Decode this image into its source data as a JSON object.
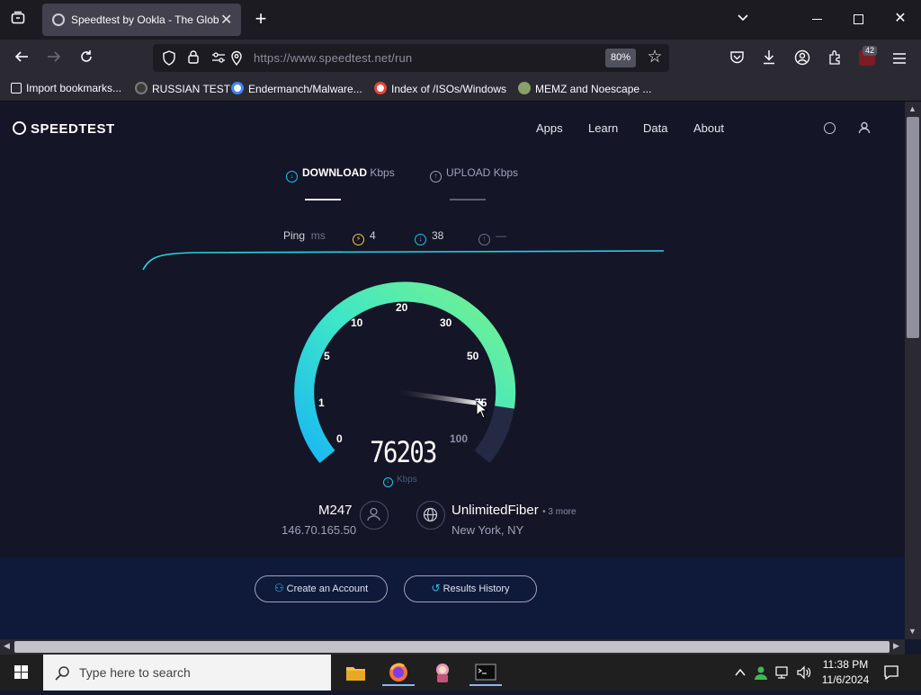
{
  "browser": {
    "tab_title": "Speedtest by Ookla - The Global Broadband Speed Test",
    "tab_close": "✕",
    "new_tab": "+",
    "url": "https://www.speedtest.net/run",
    "zoom": "80%",
    "badge_count": "42",
    "bookmarks": [
      {
        "label": "Import bookmarks...",
        "icon": "import-icon"
      },
      {
        "label": "RUSSIAN TEST",
        "icon": "github-icon"
      },
      {
        "label": "Endermanch/Malware...",
        "icon": "google-icon"
      },
      {
        "label": "Index of /ISOs/Windows",
        "icon": "google-icon"
      },
      {
        "label": "MEMZ and Noescape ...",
        "icon": "site-icon"
      }
    ]
  },
  "site": {
    "logo": "SPEEDTEST",
    "nav": [
      "Apps",
      "Learn",
      "Data",
      "About"
    ],
    "download_label": "DOWNLOAD",
    "download_unit": "Kbps",
    "upload_label": "UPLOAD",
    "upload_unit": "Kbps",
    "ping_label": "Ping",
    "ping_unit": "ms",
    "ping_idle": "4",
    "ping_download": "38",
    "ping_upload": "—",
    "gauge_ticks": [
      "0",
      "1",
      "5",
      "10",
      "20",
      "30",
      "50",
      "75",
      "100"
    ],
    "gauge_value": "76203",
    "gauge_unit": "Kbps",
    "server_name": "M247",
    "server_ip": "146.70.165.50",
    "isp_name": "UnlimitedFiber",
    "isp_more": "• 3 more",
    "isp_location": "New York, NY",
    "create_account": "Create an Account",
    "results_history": "Results History",
    "accent_download": "#1fc5f5",
    "accent_green": "#69f08e"
  },
  "taskbar": {
    "search_placeholder": "Type here to search",
    "time": "11:38 PM",
    "date": "11/6/2024"
  }
}
